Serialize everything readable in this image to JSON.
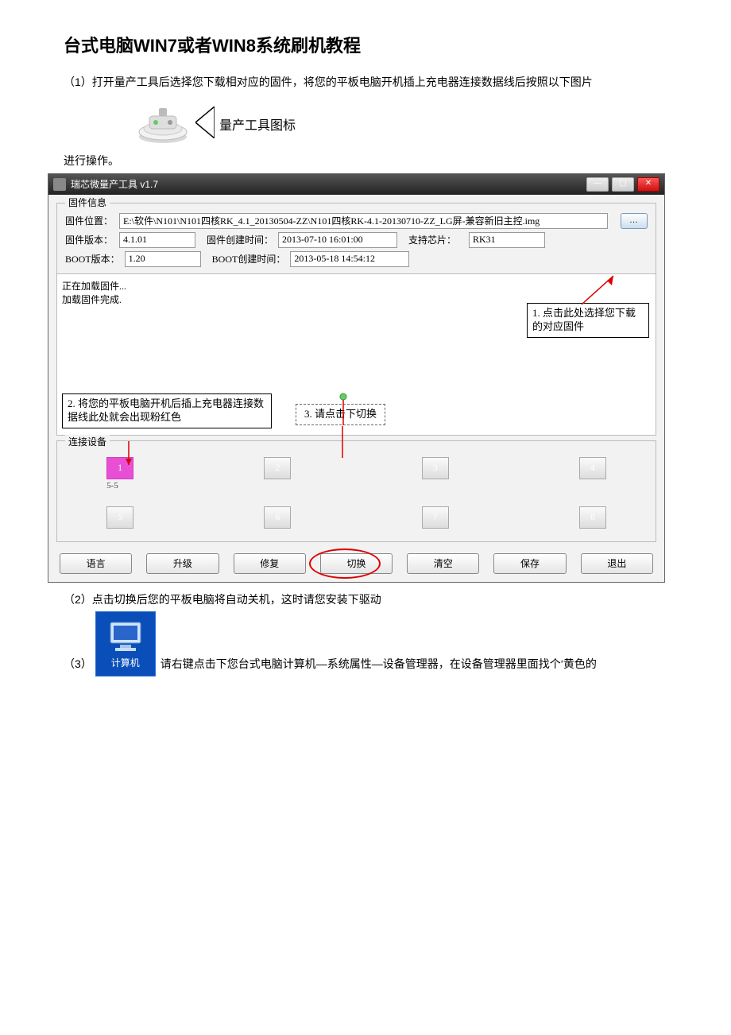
{
  "doc": {
    "title": "台式电脑WIN7或者WIN8系统刷机教程",
    "step1_intro": "（1）打开量产工具后选择您下载相对应的固件，将您的平板电脑开机插上充电器连接数据线后按照以下图片",
    "tool_icon_label": "量产工具图标",
    "step1_continue": "进行操作。",
    "step2": "（2）点击切换后您的平板电脑将自动关机，这时请您安装下驱动",
    "computer_caption": "计算机",
    "step3_prefix": "（3）",
    "step3_text": "请右键点击下您台式电脑计算机—系统属性—设备管理器，在设备管理器里面找个‘黄色的"
  },
  "app": {
    "window_title": "瑞芯微量产工具 v1.7",
    "firmware_info_legend": "固件信息",
    "labels": {
      "path": "固件位置：",
      "fw_ver": "固件版本：",
      "fw_time": "固件创建时间：",
      "chip": "支持芯片：",
      "boot_ver": "BOOT版本：",
      "boot_time": "BOOT创建时间："
    },
    "values": {
      "path": "E:\\软件\\N101\\N101四核RK_4.1_20130504-ZZ\\N101四核RK-4.1-20130710-ZZ_LG屏-兼容新旧主控.img",
      "fw_ver": "4.1.01",
      "fw_time": "2013-07-10 16:01:00",
      "chip": "RK31",
      "boot_ver": "1.20",
      "boot_time": "2013-05-18 14:54:12"
    },
    "browse_label": "...",
    "log": {
      "line1": "正在加载固件...",
      "line2": "加载固件完成."
    },
    "annotations": {
      "a1": "1. 点击此处选择您下载的对应固件",
      "a2": "2. 将您的平板电脑开机后插上充电器连接数据线此处就会出现粉红色",
      "a3": "3. 请点击下切换"
    },
    "devices_legend": "连接设备",
    "devices": [
      "1",
      "2",
      "3",
      "4",
      "5",
      "6",
      "7",
      "8"
    ],
    "device_sub": "5-5",
    "buttons": {
      "lang": "语言",
      "upgrade": "升级",
      "repair": "修复",
      "switch": "切换",
      "clear": "清空",
      "save": "保存",
      "exit": "退出"
    }
  }
}
